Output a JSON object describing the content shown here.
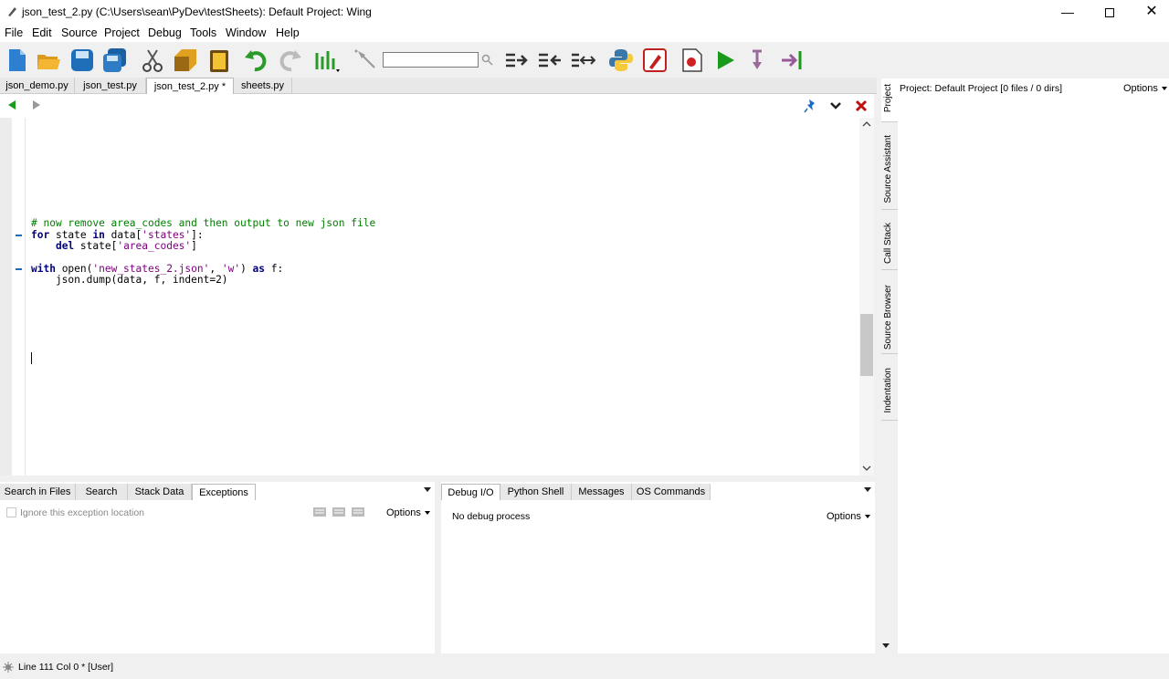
{
  "window": {
    "title": "json_test_2.py (C:\\Users\\sean\\PyDev\\testSheets): Default Project: Wing"
  },
  "menu": [
    "File",
    "Edit",
    "Source",
    "Project",
    "Debug",
    "Tools",
    "Window",
    "Help"
  ],
  "toolbar": {
    "search_value": ""
  },
  "editor_tabs": [
    {
      "label": "json_demo.py"
    },
    {
      "label": "json_test.py"
    },
    {
      "label": "json_test_2.py *"
    },
    {
      "label": "sheets.py"
    }
  ],
  "code": {
    "comment": "# now remove area_codes and then output to new json file",
    "line_for": [
      {
        "t": "for",
        "c": "kw"
      },
      {
        "t": " state ",
        "c": ""
      },
      {
        "t": "in",
        "c": "kw"
      },
      {
        "t": " data[",
        "c": ""
      },
      {
        "t": "'states'",
        "c": "st"
      },
      {
        "t": "]:",
        "c": ""
      }
    ],
    "line_del": [
      {
        "t": "    ",
        "c": ""
      },
      {
        "t": "del",
        "c": "kw"
      },
      {
        "t": " state[",
        "c": ""
      },
      {
        "t": "'area_codes'",
        "c": "st"
      },
      {
        "t": "]",
        "c": ""
      }
    ],
    "line_with": [
      {
        "t": "with",
        "c": "kw"
      },
      {
        "t": " open(",
        "c": ""
      },
      {
        "t": "'new_states_2.json'",
        "c": "st"
      },
      {
        "t": ", ",
        "c": ""
      },
      {
        "t": "'w'",
        "c": "st"
      },
      {
        "t": ") ",
        "c": ""
      },
      {
        "t": "as",
        "c": "kw"
      },
      {
        "t": " f:",
        "c": ""
      }
    ],
    "line_dump": [
      {
        "t": "    json.dump(data, f, indent=2)",
        "c": ""
      }
    ]
  },
  "bottom_left": {
    "tabs": [
      "Search in Files",
      "Search",
      "Stack Data",
      "Exceptions"
    ],
    "checkbox_label": "Ignore this exception location",
    "options_label": "Options"
  },
  "bottom_right": {
    "tabs": [
      "Debug I/O",
      "Python Shell",
      "Messages",
      "OS Commands"
    ],
    "status": "No debug process",
    "options_label": "Options"
  },
  "right_panel": {
    "vertical_tabs": [
      "Project",
      "Source Assistant",
      "Call Stack",
      "Source Browser",
      "Indentation"
    ],
    "project_label": "Project: Default Project [0 files / 0 dirs]",
    "options_label": "Options"
  },
  "status_bar": {
    "text": "Line 111 Col 0 * [User]"
  },
  "colors": {
    "keyword": "#000080",
    "comment": "#008000",
    "string": "#800080"
  }
}
